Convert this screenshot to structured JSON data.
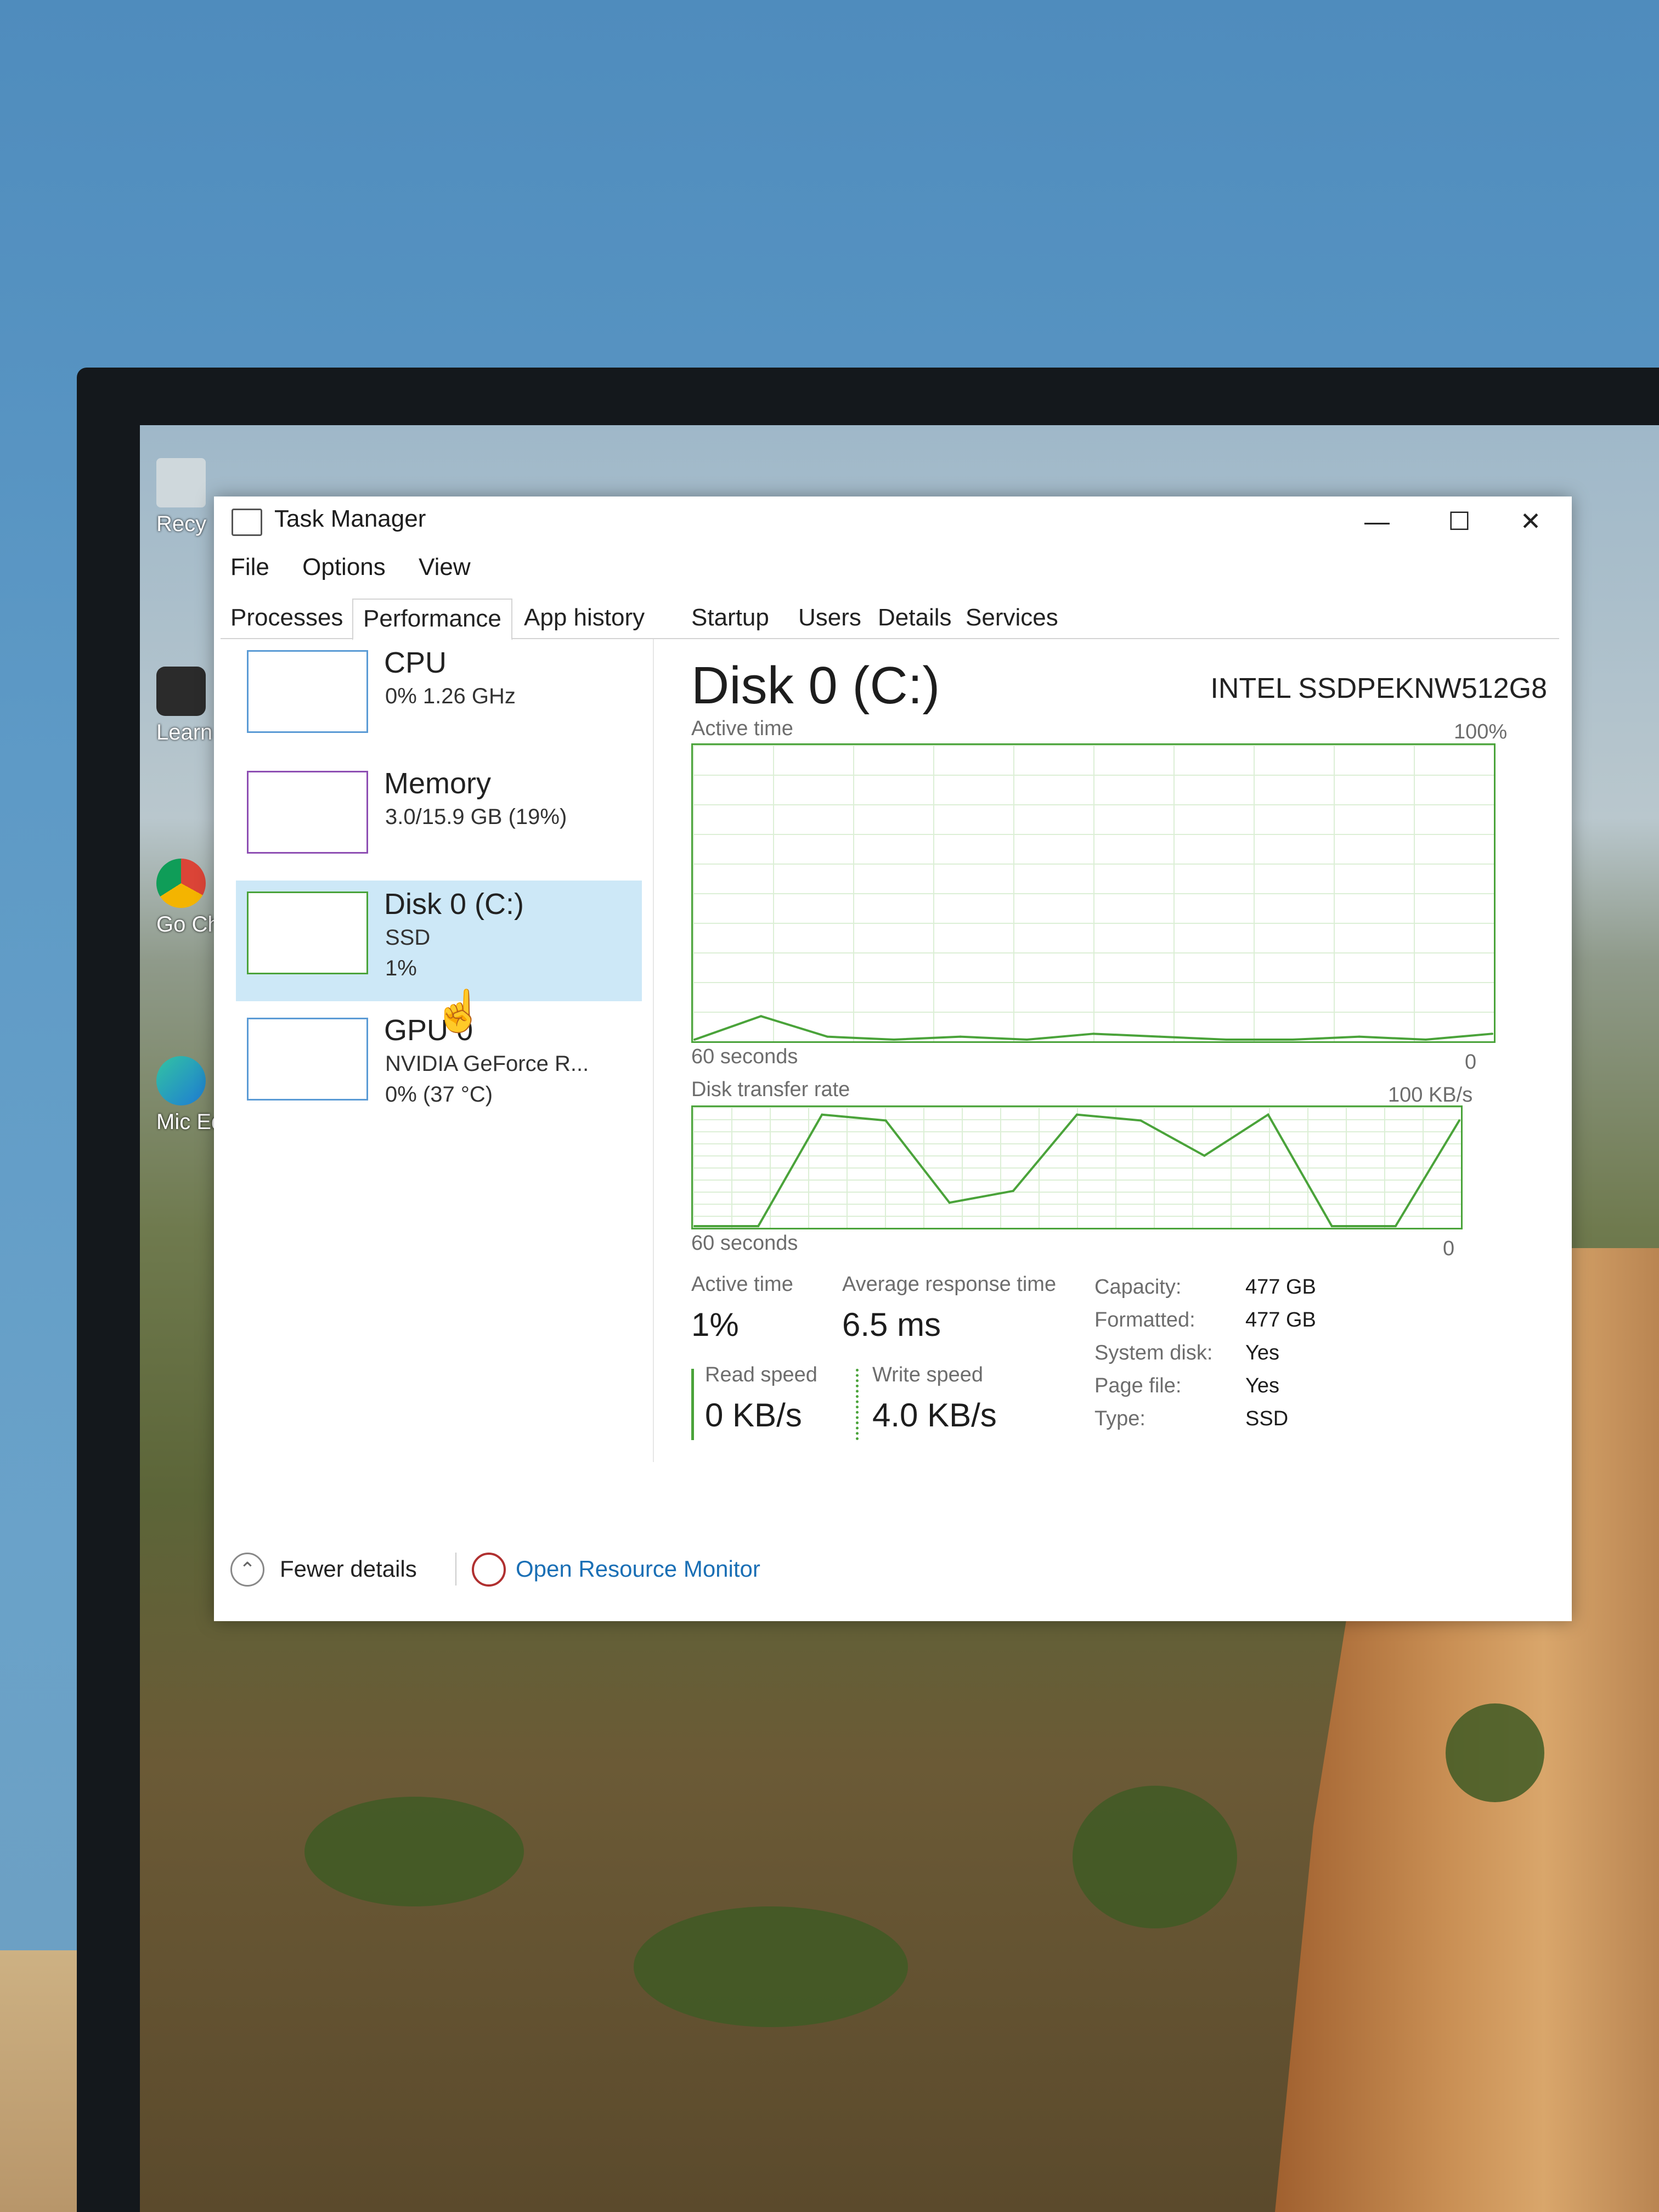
{
  "window": {
    "title": "Task Manager",
    "controls": {
      "minimize": "—",
      "maximize": "☐",
      "close": "✕"
    }
  },
  "menu": [
    "File",
    "Options",
    "View"
  ],
  "tabs": [
    "Processes",
    "Performance",
    "App history",
    "Startup",
    "Users",
    "Details",
    "Services"
  ],
  "active_tab": "Performance",
  "sidebar": {
    "items": [
      {
        "title": "CPU",
        "line1": "0% 1.26 GHz",
        "line2": ""
      },
      {
        "title": "Memory",
        "line1": "3.0/15.9 GB (19%)",
        "line2": ""
      },
      {
        "title": "Disk 0 (C:)",
        "line1": "SSD",
        "line2": "1%"
      },
      {
        "title": "GPU 0",
        "line1": "NVIDIA GeForce R...",
        "line2": "0% (37 °C)"
      }
    ]
  },
  "main": {
    "title": "Disk 0 (C:)",
    "model": "INTEL SSDPEKNW512G8",
    "graph1": {
      "label": "Active time",
      "max": "100%",
      "xlabel": "60 seconds",
      "min": "0"
    },
    "graph2": {
      "label": "Disk transfer rate",
      "max": "100 KB/s",
      "xlabel": "60 seconds",
      "min": "0"
    },
    "stats": {
      "active_time_label": "Active time",
      "active_time": "1%",
      "avg_resp_label": "Average response time",
      "avg_resp": "6.5 ms",
      "read_label": "Read speed",
      "read": "0 KB/s",
      "write_label": "Write speed",
      "write": "4.0 KB/s"
    },
    "props": [
      {
        "k": "Capacity:",
        "v": "477 GB"
      },
      {
        "k": "Formatted:",
        "v": "477 GB"
      },
      {
        "k": "System disk:",
        "v": "Yes"
      },
      {
        "k": "Page file:",
        "v": "Yes"
      },
      {
        "k": "Type:",
        "v": "SSD"
      }
    ]
  },
  "footer": {
    "fewer": "Fewer details",
    "resource_monitor": "Open Resource Monitor"
  },
  "desktop_icons": [
    "Recy",
    "Learn this p",
    "Go Ch",
    "Mic Ed"
  ],
  "colors": {
    "accent_green": "#4aa33a",
    "selected_bg": "#cde8f7",
    "link_blue": "#1a6fb5"
  },
  "chart_data": [
    {
      "type": "line",
      "title": "Active time",
      "x": [
        60,
        55,
        50,
        45,
        40,
        35,
        30,
        25,
        20,
        15,
        10,
        5,
        0
      ],
      "values": [
        0,
        8,
        1,
        0,
        1,
        0,
        2,
        1,
        0,
        0,
        1,
        0,
        2
      ],
      "ylim": [
        0,
        100
      ]
    },
    {
      "type": "line",
      "title": "Disk transfer rate",
      "x": [
        60,
        55,
        50,
        45,
        40,
        35,
        30,
        25,
        20,
        15,
        10,
        5,
        0
      ],
      "values": [
        0,
        0,
        95,
        90,
        20,
        30,
        95,
        90,
        60,
        95,
        0,
        0,
        90
      ],
      "ylim": [
        0,
        100
      ]
    }
  ]
}
